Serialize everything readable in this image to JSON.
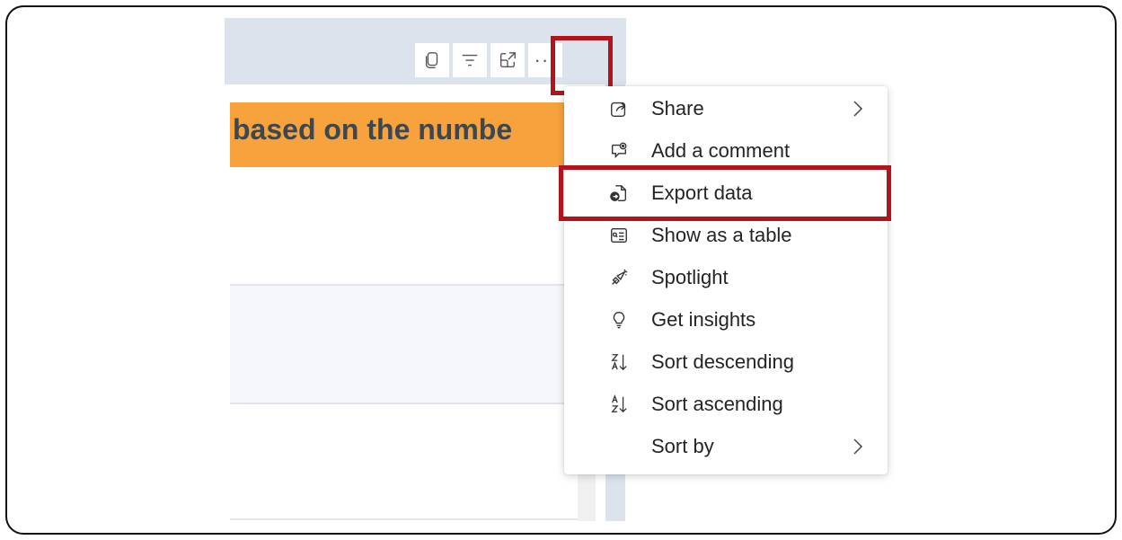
{
  "visual": {
    "title_fragment": "based on the numbe",
    "toolbar": {
      "copy_icon": "copy-icon",
      "filter_icon": "filter-icon",
      "focus_icon": "focus-mode-icon",
      "more_label": "···"
    }
  },
  "menu": {
    "items": [
      {
        "label": "Share",
        "icon": "share-icon",
        "submenu": true
      },
      {
        "label": "Add a comment",
        "icon": "comment-icon",
        "submenu": false
      },
      {
        "label": "Export data",
        "icon": "export-data-icon",
        "submenu": false,
        "highlighted": true
      },
      {
        "label": "Show as a table",
        "icon": "table-view-icon",
        "submenu": false
      },
      {
        "label": "Spotlight",
        "icon": "spotlight-icon",
        "submenu": false
      },
      {
        "label": "Get insights",
        "icon": "lightbulb-icon",
        "submenu": false
      },
      {
        "label": "Sort descending",
        "icon": "sort-descending-icon",
        "submenu": false
      },
      {
        "label": "Sort ascending",
        "icon": "sort-ascending-icon",
        "submenu": false
      },
      {
        "label": "Sort by",
        "icon": "",
        "submenu": true
      }
    ]
  },
  "colors": {
    "highlight_border": "#b3141c",
    "banner": "#f7a23d",
    "header_bg": "#dde3ec"
  }
}
